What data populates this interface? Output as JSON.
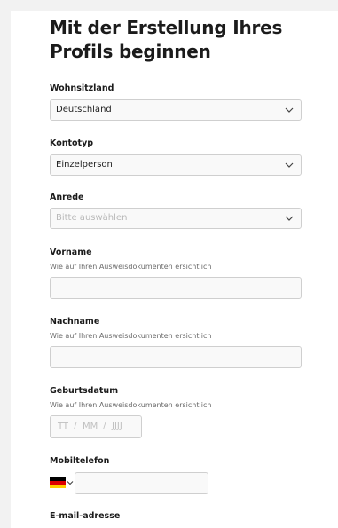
{
  "header": {
    "title": "Mit der Erstellung Ihres Profils beginnen"
  },
  "fields": {
    "residence": {
      "label": "Wohnsitzland",
      "value": "Deutschland"
    },
    "account_type": {
      "label": "Kontotyp",
      "value": "Einzelperson"
    },
    "salutation": {
      "label": "Anrede",
      "placeholder": "Bitte auswählen"
    },
    "first_name": {
      "label": "Vorname",
      "hint": "Wie auf Ihren Ausweisdokumenten ersichtlich",
      "value": ""
    },
    "last_name": {
      "label": "Nachname",
      "hint": "Wie auf Ihren Ausweisdokumenten ersichtlich",
      "value": ""
    },
    "birthdate": {
      "label": "Geburtsdatum",
      "hint": "Wie auf Ihren Ausweisdokumenten ersichtlich",
      "day_placeholder": "TT",
      "month_placeholder": "MM",
      "year_placeholder": "JJJJ",
      "separator": "/"
    },
    "mobile": {
      "label": "Mobiltelefon",
      "country_icon": "germany-flag-icon",
      "value": ""
    },
    "email": {
      "label": "E-mail-adresse"
    }
  },
  "colors": {
    "field_border": "#cfcfcf",
    "field_bg": "#f9f9f9",
    "placeholder": "#b9b9b9",
    "flag": [
      "#000000",
      "#dd0000",
      "#ffce00"
    ]
  }
}
